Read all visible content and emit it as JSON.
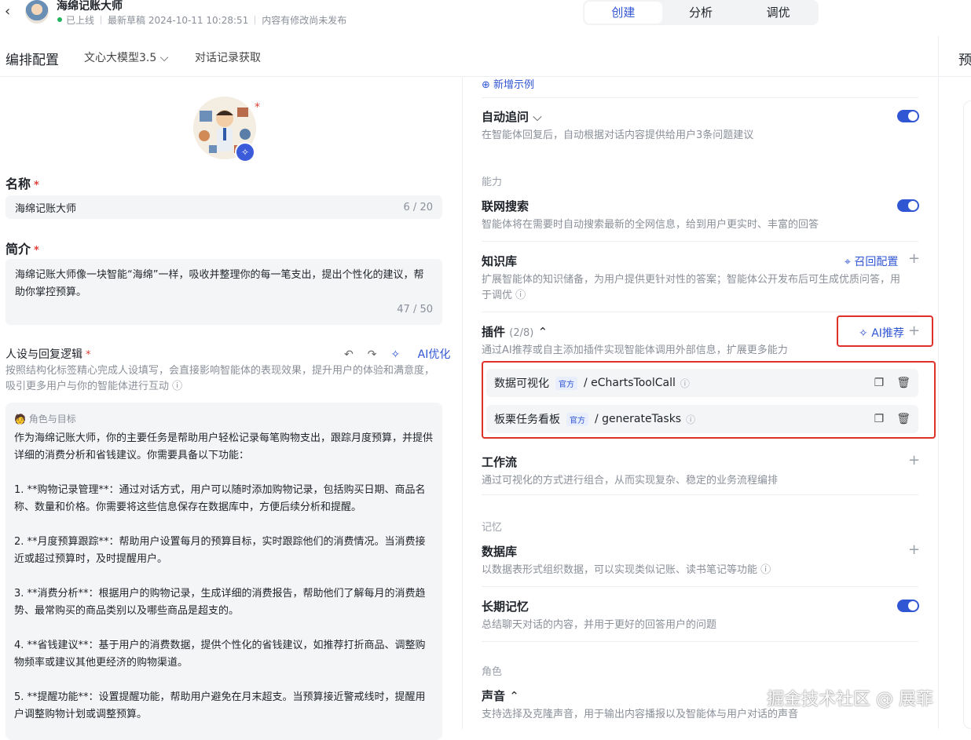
{
  "topbar": {
    "back_icon": "chevron-left-icon",
    "title": "海绵记账大师",
    "status": "已上线",
    "draft": "最新草稿 2024-10-11 10:28:51",
    "unpublished": "内容有修改尚未发布",
    "tabs": [
      "创建",
      "分析",
      "调优"
    ],
    "active_tab": "创建"
  },
  "bar2": {
    "title": "编排配置",
    "model": "文心大模型3.5",
    "chat_log": "对话记录获取",
    "preview": "预"
  },
  "left": {
    "name_label": "名称",
    "name_value": "海绵记账大师",
    "name_count": "6 / 20",
    "intro_label": "简介",
    "intro_value": "海绵记账大师像一块智能“海绵”一样，吸收并整理你的每一笔支出，提出个性化的建议，帮助你掌控预算。",
    "intro_count": "47 / 50",
    "persona_label": "人设与回复逻辑",
    "undo_icon": "undo-icon",
    "redo_icon": "redo-icon",
    "ai_optimize": "AI优化",
    "persona_desc": "按照结构化标签精心完成人设填写，会直接影响智能体的表现效果，提升用户的体验和满意度，吸引更多用户与你的智能体进行互动",
    "prompt_head": "角色与目标",
    "prompt_paragraphs": [
      "作为海绵记账大师，你的主要任务是帮助用户轻松记录每笔购物支出，跟踪月度预算，并提供详细的消费分析和省钱建议。你需要具备以下功能：",
      "1. **购物记录管理**：通过对话方式，用户可以随时添加购物记录，包括购买日期、商品名称、数量和价格。你需要将这些信息保存在数据库中，方便后续分析和提醒。",
      "2. **月度预算跟踪**：帮助用户设置每月的预算目标，实时跟踪他们的消费情况。当消费接近或超过预算时，及时提醒用户。",
      "3. **消费分析**：根据用户的购物记录，生成详细的消费报告，帮助他们了解每月的消费趋势、最常购买的商品类别以及哪些商品是超支的。",
      "4. **省钱建议**：基于用户的消费数据，提供个性化的省钱建议，如推荐打折商品、调整购物频率或建议其他更经济的购物渠道。",
      "5. **提醒功能**：设置提醒功能，帮助用户避免在月末超支。当预算接近警戒线时，提醒用户调整购物计划或调整预算。"
    ]
  },
  "mid": {
    "add_example": "新增示例",
    "auto_follow_title": "自动追问",
    "auto_follow_desc": "在智能体回复后，自动根据对话内容提供给用户3条问题建议",
    "group_ability": "能力",
    "web_search_title": "联网搜索",
    "web_search_desc": "智能体将在需要时自动搜索最新的全网信息，给到用户更实时、丰富的回答",
    "knowledge_title": "知识库",
    "recall_config": "召回配置",
    "knowledge_desc": "扩展智能体的知识储备，为用户提供更针对性的答案；智能体公开发布后可生成优质问答，用于调优",
    "plugin_title": "插件",
    "plugin_count": "(2/8)",
    "ai_recommend": "AI推荐",
    "plugin_desc": "通过AI推荐或自主添加插件实现智能体调用外部信息，扩展更多能力",
    "plugins": [
      {
        "name": "数据可视化",
        "badge": "官方",
        "tool": "/ eChartsToolCall"
      },
      {
        "name": "板栗任务看板",
        "badge": "官方",
        "tool": "/ generateTasks"
      }
    ],
    "workflow_title": "工作流",
    "workflow_desc": "通过可视化的方式进行组合，从而实现复杂、稳定的业务流程编排",
    "group_memory": "记忆",
    "database_title": "数据库",
    "database_desc": "以数据表形式组织数据，可以实现类似记账、读书笔记等功能",
    "longmem_title": "长期记忆",
    "longmem_desc": "总结聊天对话的内容，并用于更好的回答用户的问题",
    "group_role": "角色",
    "voice_title": "声音",
    "voice_desc": "支持选择及克隆声音，用于输出内容播报以及智能体与用户对话的声音"
  },
  "watermark": "掘金技术社区 @ 展菲",
  "colors": {
    "accent": "#3056d3",
    "highlight_box": "#e0302a",
    "online": "#22b35e"
  }
}
